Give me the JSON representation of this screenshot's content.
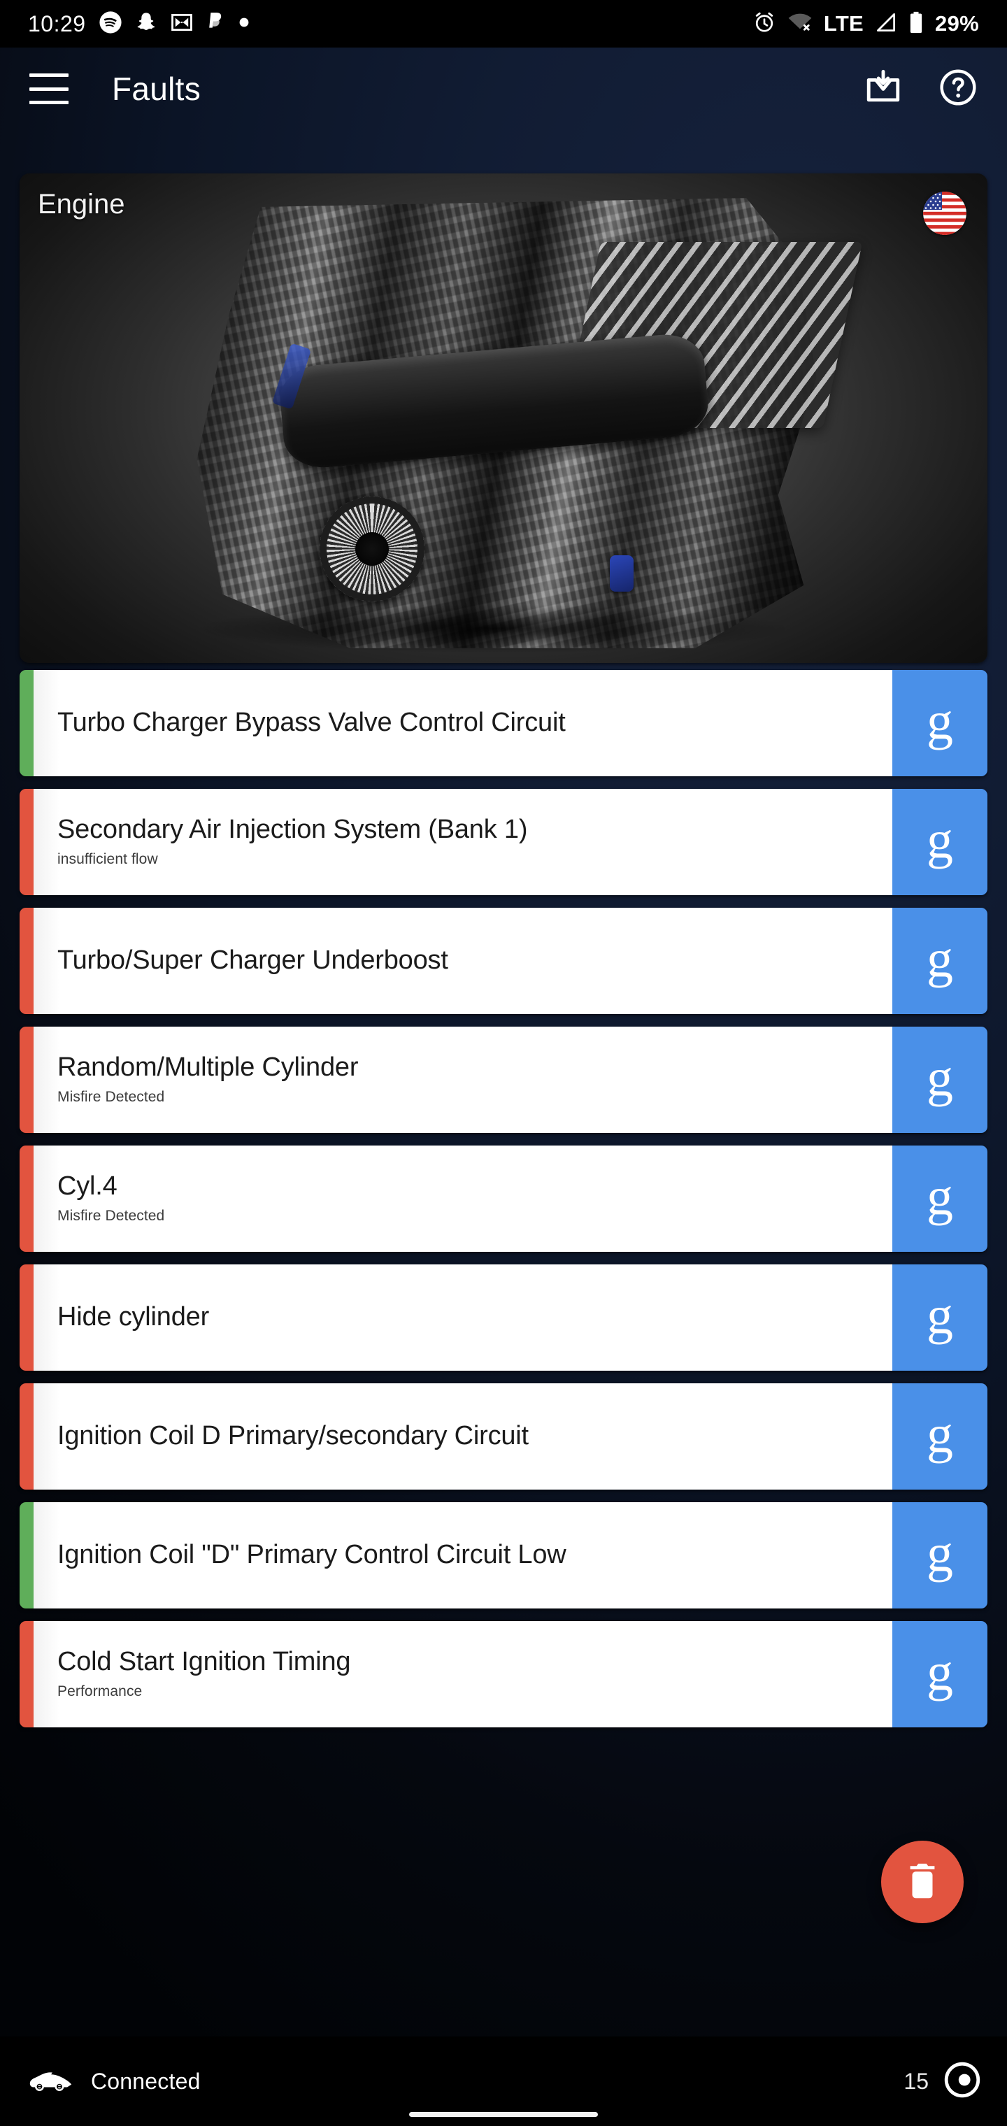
{
  "status_bar": {
    "time": "10:29",
    "left_icons": [
      "spotify-icon",
      "snapchat-icon",
      "gmail-icon",
      "paypal-icon",
      "dot-icon"
    ],
    "right_icons": [
      "alarm-icon",
      "wifi-off-icon",
      "signal-icon"
    ],
    "network_label": "LTE",
    "battery_percent": "29%"
  },
  "app_bar": {
    "menu_icon": "hamburger-menu-icon",
    "title": "Faults",
    "actions": [
      {
        "name": "inbox-download-icon"
      },
      {
        "name": "help-icon"
      }
    ]
  },
  "hero": {
    "label": "Engine",
    "flag": "us-flag-icon",
    "image": "engine-photo"
  },
  "faults": [
    {
      "title": "Turbo Charger Bypass Valve Control Circuit",
      "subtitle": "",
      "severity": "green",
      "action": "g"
    },
    {
      "title": "Secondary Air Injection System (Bank 1)",
      "subtitle": "insufficient flow",
      "severity": "red",
      "action": "g"
    },
    {
      "title": "Turbo/Super Charger Underboost",
      "subtitle": "",
      "severity": "red",
      "action": "g"
    },
    {
      "title": "Random/Multiple Cylinder",
      "subtitle": "Misfire Detected",
      "severity": "red",
      "action": "g"
    },
    {
      "title": "Cyl.4",
      "subtitle": "Misfire Detected",
      "severity": "red",
      "action": "g"
    },
    {
      "title": "Hide cylinder",
      "subtitle": "",
      "severity": "red",
      "action": "g"
    },
    {
      "title": "Ignition Coil D Primary/secondary Circuit",
      "subtitle": "",
      "severity": "red",
      "action": "g"
    },
    {
      "title": "Ignition Coil \"D\" Primary Control Circuit Low",
      "subtitle": "",
      "severity": "green",
      "action": "g"
    },
    {
      "title": "Cold Start Ignition Timing",
      "subtitle": "Performance",
      "severity": "red",
      "action": "g"
    }
  ],
  "fab": {
    "icon": "delete-trash-icon"
  },
  "bottom_bar": {
    "car_icon": "car-icon",
    "status_text": "Connected",
    "count": "15",
    "logo_icon": "app-logo-icon"
  },
  "colors": {
    "severity_red": "#e2543f",
    "severity_green": "#5fae5a",
    "google_blue": "#4a90e8",
    "fab_red": "#e2543f",
    "background_navy": "#111c33"
  }
}
